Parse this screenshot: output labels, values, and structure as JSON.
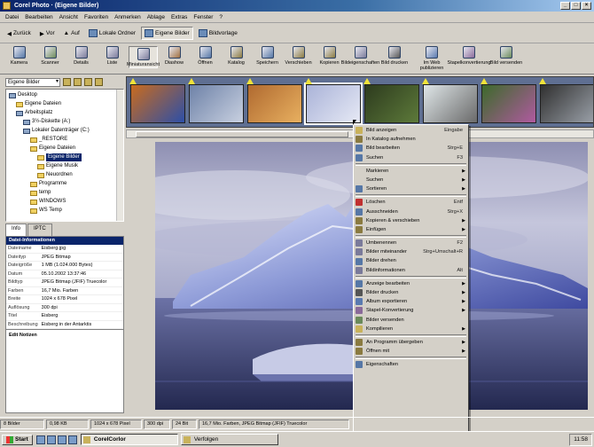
{
  "window": {
    "title": "Corel Photo · (Eigene Bilder)",
    "buttons": [
      "_",
      "□",
      "×"
    ]
  },
  "menu": [
    "Datei",
    "Bearbeiten",
    "Ansicht",
    "Favoriten",
    "Anmerken",
    "Ablage",
    "Extras",
    "Fenster",
    "?"
  ],
  "nav": {
    "back": "Zurück",
    "forward": "Vor",
    "up": "Auf",
    "items": [
      {
        "label": "Lokale Ordner",
        "active": false
      },
      {
        "label": "Eigene Bilder",
        "active": true
      },
      {
        "label": "Bildvorlage",
        "active": false
      }
    ]
  },
  "toolbar": [
    {
      "label": "Kamera",
      "color": "#5677a6"
    },
    {
      "label": "Scanner",
      "color": "#6d8a5a"
    },
    {
      "label": "Details",
      "color": "#7a7a9a"
    },
    {
      "label": "Liste",
      "color": "#7a7a9a"
    },
    {
      "label": "Miniaturansicht",
      "color": "#7a7a9a",
      "active": true
    },
    {
      "label": "Diashow",
      "color": "#a07040"
    },
    {
      "label": "Öffnen",
      "color": "#5677a6"
    },
    {
      "label": "Katalog",
      "color": "#8a7a40"
    },
    {
      "label": "Speichern",
      "color": "#5677a6"
    },
    {
      "label": "Verschieben",
      "color": "#8a7a40"
    },
    {
      "label": "Kopieren",
      "color": "#8a7a40"
    },
    {
      "label": "Bildeigenschaften",
      "color": "#7a7a9a"
    },
    {
      "label": "Bild drucken",
      "color": "#555",
      "wide": true
    },
    {
      "label": "Im Web publizieren",
      "color": "#5a7ab0",
      "wide": true
    },
    {
      "label": "Stapelkonvertierung",
      "color": "#8a6a9a",
      "wide": true
    },
    {
      "label": "Bild versenden",
      "color": "#6a8a5a",
      "wide": true
    }
  ],
  "tree": {
    "combo": "Eigene Bilder",
    "nodes": [
      {
        "label": "Desktop",
        "indent": 0,
        "pc": true
      },
      {
        "label": "Eigene Dateien",
        "indent": 1,
        "pc": false
      },
      {
        "label": "Arbeitsplatz",
        "indent": 1,
        "pc": true
      },
      {
        "label": "3½-Diskette (A:)",
        "indent": 2,
        "pc": true
      },
      {
        "label": "Lokaler Datenträger (C:)",
        "indent": 2,
        "pc": true
      },
      {
        "label": "_RESTORE",
        "indent": 3,
        "pc": false
      },
      {
        "label": "Eigene Dateien",
        "indent": 3,
        "pc": false
      },
      {
        "label": "Eigene Bilder",
        "indent": 4,
        "pc": false,
        "selected": true
      },
      {
        "label": "Eigene Musik",
        "indent": 4,
        "pc": false
      },
      {
        "label": "Neuordnen",
        "indent": 4,
        "pc": false
      },
      {
        "label": "Programme",
        "indent": 3,
        "pc": false
      },
      {
        "label": "temp",
        "indent": 3,
        "pc": false
      },
      {
        "label": "WINDOWS",
        "indent": 3,
        "pc": false
      },
      {
        "label": "WS Temp",
        "indent": 3,
        "pc": false
      }
    ]
  },
  "info": {
    "tabs": [
      "Info",
      "IPTC"
    ],
    "header": "Datei-Informationen",
    "rows": [
      {
        "k": "Dateiname",
        "v": "Eisberg.jpg"
      },
      {
        "k": "Dateityp",
        "v": "JPEG Bitmap"
      },
      {
        "k": "Dateigröße",
        "v": "1 MB (1.024.000 Bytes)"
      },
      {
        "k": "Datum",
        "v": "05.10.2002 13:37:46"
      },
      {
        "k": "Bildtyp",
        "v": "JPEG Bitmap (JFIF) Truecolor"
      },
      {
        "k": "Farben",
        "v": "16,7 Mio. Farben"
      },
      {
        "k": "Breite",
        "v": "1024 x 678 Pixel"
      },
      {
        "k": "Auflösung",
        "v": "300 dpi"
      },
      {
        "k": "Titel",
        "v": "Eisberg"
      },
      {
        "k": "Beschreibung",
        "v": "Eisberg in der Antarktis"
      }
    ],
    "footer": "Edit Notizen"
  },
  "thumbs": [
    {
      "c1": "#c96b1e",
      "c2": "#2c4fa8"
    },
    {
      "c1": "#6e82a8",
      "c2": "#c8d0e0"
    },
    {
      "c1": "#b06a30",
      "c2": "#e8b060"
    },
    {
      "c1": "#aab3d8",
      "c2": "#e6e9f5"
    },
    {
      "c1": "#2d3b1e",
      "c2": "#5d7a3a"
    },
    {
      "c1": "#dfe6e8",
      "c2": "#6a6a6a"
    },
    {
      "c1": "#3c6a2a",
      "c2": "#b05aa0"
    },
    {
      "c1": "#303030",
      "c2": "#9aa0a8"
    }
  ],
  "menu_ctx": [
    {
      "label": "Bild anzeigen",
      "shortcut": "Eingabe",
      "color": "#c9b25b"
    },
    {
      "label": "In Katalog aufnehmen",
      "color": "#8a7a40"
    },
    {
      "label": "Bild bearbeiten",
      "shortcut": "Strg+E",
      "color": "#5677a6"
    },
    {
      "label": "Suchen",
      "shortcut": "F3",
      "color": "#5677a6"
    },
    {
      "sep": true
    },
    {
      "label": "Markieren",
      "sub": true,
      "color": "#d4d0c8"
    },
    {
      "label": "Suchen",
      "sub": true,
      "color": "#d4d0c8"
    },
    {
      "label": "Sortieren",
      "sub": true,
      "color": "#5677a6"
    },
    {
      "sep": true
    },
    {
      "label": "Löschen",
      "shortcut": "Entf",
      "color": "#c03030"
    },
    {
      "label": "Ausschneiden",
      "shortcut": "Strg+X",
      "color": "#5677a6"
    },
    {
      "label": "Kopieren & verschieben",
      "sub": true,
      "color": "#8a7a40"
    },
    {
      "label": "Einfügen",
      "sub": true,
      "color": "#8a7a40"
    },
    {
      "sep": true
    },
    {
      "label": "Umbenennen",
      "shortcut": "F2",
      "color": "#7a7a9a"
    },
    {
      "label": "Bilder miteinander",
      "shortcut": "Strg+Umschalt+R",
      "color": "#7a7a9a"
    },
    {
      "label": "Bilder drehen",
      "color": "#5677a6"
    },
    {
      "label": "Bildinformationen",
      "shortcut": "Alt",
      "color": "#7a7a9a"
    },
    {
      "sep": true
    },
    {
      "label": "Anzeige bearbeiten",
      "sub": true,
      "color": "#5677a6"
    },
    {
      "label": "Bilder drucken",
      "sub": true,
      "color": "#555555"
    },
    {
      "label": "Album exportieren",
      "sub": true,
      "color": "#5a7ab0"
    },
    {
      "label": "Stapel-Konvertierung",
      "sub": true,
      "color": "#8a6a9a"
    },
    {
      "label": "Bilder versenden",
      "color": "#6a8a5a"
    },
    {
      "label": "Kompilieren",
      "sub": true,
      "color": "#c9b25b"
    },
    {
      "sep": true
    },
    {
      "label": "An Programm übergeben",
      "sub": true,
      "color": "#8a7a40"
    },
    {
      "label": "Öffnen mit",
      "sub": true,
      "color": "#8a7a40"
    },
    {
      "sep": true
    },
    {
      "label": "Eigenschaften",
      "color": "#5677a6"
    }
  ],
  "status": [
    "8 Bilder",
    "0,98 KB",
    "1024 x 678 Pixel",
    "300 dpi",
    "24 Bit",
    "16,7 Mio. Farben, JPEG Bitmap (JFIF) Truecolor"
  ],
  "taskbar": {
    "start": "Start",
    "tasks": [
      {
        "label": "CorelCorlor",
        "active": true
      },
      {
        "label": "Verfolgen",
        "active": false
      }
    ],
    "clock": "11:58"
  }
}
